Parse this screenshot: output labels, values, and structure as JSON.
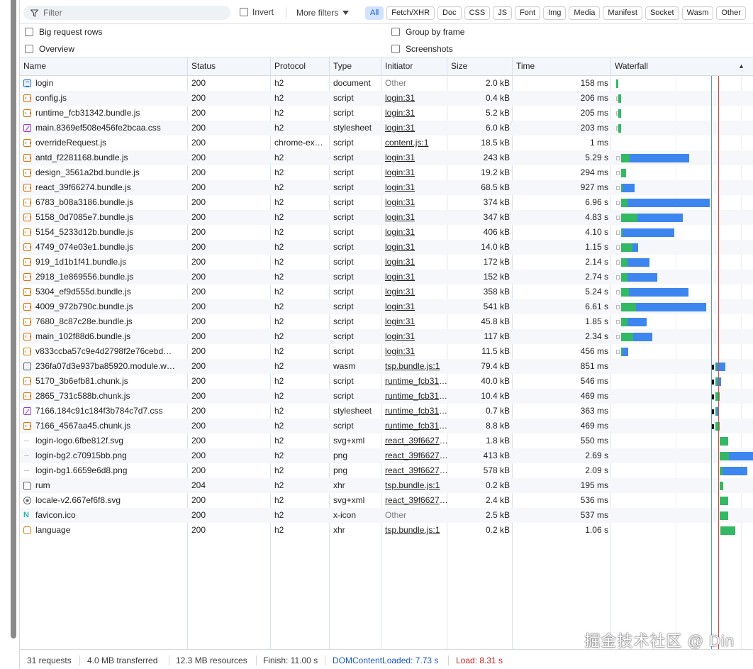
{
  "toolbar": {
    "filter_placeholder": "Filter",
    "invert_label": "Invert",
    "more_filters_label": "More filters",
    "chips": [
      {
        "label": "All",
        "active": true
      },
      {
        "label": "Fetch/XHR",
        "active": false
      },
      {
        "label": "Doc",
        "active": false
      },
      {
        "label": "CSS",
        "active": false
      },
      {
        "label": "JS",
        "active": false
      },
      {
        "label": "Font",
        "active": false
      },
      {
        "label": "Img",
        "active": false
      },
      {
        "label": "Media",
        "active": false
      },
      {
        "label": "Manifest",
        "active": false
      },
      {
        "label": "Socket",
        "active": false
      },
      {
        "label": "Wasm",
        "active": false
      },
      {
        "label": "Other",
        "active": false
      }
    ]
  },
  "options": {
    "big_request_rows": "Big request rows",
    "overview": "Overview",
    "group_by_frame": "Group by frame",
    "screenshots": "Screenshots"
  },
  "columns": {
    "name": "Name",
    "status": "Status",
    "protocol": "Protocol",
    "type": "Type",
    "initiator": "Initiator",
    "size": "Size",
    "time": "Time",
    "waterfall": "Waterfall",
    "waterfall_sort": "▲"
  },
  "rows": [
    {
      "icon": "document",
      "name": "login",
      "status": "200",
      "protocol": "h2",
      "type": "document",
      "initiator": "Other",
      "initiator_link": false,
      "size": "2.0 kB",
      "time": "158 ms",
      "wf": [
        [
          "w",
          6,
          3
        ]
      ]
    },
    {
      "icon": "script",
      "name": "config.js",
      "status": "200",
      "protocol": "h2",
      "type": "script",
      "initiator": "login:31",
      "initiator_link": true,
      "size": "0.4 kB",
      "time": "206 ms",
      "wf": [
        [
          "q",
          6,
          3
        ],
        [
          "w",
          9,
          4
        ]
      ]
    },
    {
      "icon": "script",
      "name": "runtime_fcb31342.bundle.js",
      "status": "200",
      "protocol": "h2",
      "type": "script",
      "initiator": "login:31",
      "initiator_link": true,
      "size": "5.2 kB",
      "time": "205 ms",
      "wf": [
        [
          "q",
          6,
          3
        ],
        [
          "w",
          9,
          4
        ]
      ]
    },
    {
      "icon": "stylesheet",
      "name": "main.8369ef508e456fe2bcaa.css",
      "status": "200",
      "protocol": "h2",
      "type": "stylesheet",
      "initiator": "login:31",
      "initiator_link": true,
      "size": "6.0 kB",
      "time": "203 ms",
      "wf": [
        [
          "q",
          6,
          3
        ],
        [
          "w",
          9,
          4
        ]
      ]
    },
    {
      "icon": "script",
      "name": "overrideRequest.js",
      "status": "200",
      "protocol": "chrome-ex…",
      "type": "script",
      "initiator": "content.js:1",
      "initiator_link": true,
      "size": "18.5 kB",
      "time": "1 ms",
      "wf": []
    },
    {
      "icon": "script",
      "name": "antd_f2281168.bundle.js",
      "status": "200",
      "protocol": "h2",
      "type": "script",
      "initiator": "login:31",
      "initiator_link": true,
      "size": "243 kB",
      "time": "5.29 s",
      "wf": [
        [
          "q",
          6,
          5
        ],
        [
          "w",
          13,
          12
        ],
        [
          "d",
          25,
          84
        ]
      ]
    },
    {
      "icon": "script",
      "name": "design_3561a2bd.bundle.js",
      "status": "200",
      "protocol": "h2",
      "type": "script",
      "initiator": "login:31",
      "initiator_link": true,
      "size": "19.2 kB",
      "time": "294 ms",
      "wf": [
        [
          "q",
          6,
          5
        ],
        [
          "w",
          13,
          7
        ]
      ]
    },
    {
      "icon": "script",
      "name": "react_39f66274.bundle.js",
      "status": "200",
      "protocol": "h2",
      "type": "script",
      "initiator": "login:31",
      "initiator_link": true,
      "size": "68.5 kB",
      "time": "927 ms",
      "wf": [
        [
          "q",
          6,
          5
        ],
        [
          "w",
          13,
          2
        ],
        [
          "d",
          15,
          17
        ]
      ]
    },
    {
      "icon": "script",
      "name": "6783_b08a3186.bundle.js",
      "status": "200",
      "protocol": "h2",
      "type": "script",
      "initiator": "login:31",
      "initiator_link": true,
      "size": "374 kB",
      "time": "6.96 s",
      "wf": [
        [
          "q",
          6,
          5
        ],
        [
          "w",
          13,
          9
        ],
        [
          "d",
          22,
          116
        ]
      ]
    },
    {
      "icon": "script",
      "name": "5158_0d7085e7.bundle.js",
      "status": "200",
      "protocol": "h2",
      "type": "script",
      "initiator": "login:31",
      "initiator_link": true,
      "size": "347 kB",
      "time": "4.83 s",
      "wf": [
        [
          "q",
          6,
          5
        ],
        [
          "w",
          13,
          23
        ],
        [
          "d",
          36,
          64
        ]
      ]
    },
    {
      "icon": "script",
      "name": "5154_5233d12b.bundle.js",
      "status": "200",
      "protocol": "h2",
      "type": "script",
      "initiator": "login:31",
      "initiator_link": true,
      "size": "406 kB",
      "time": "4.10 s",
      "wf": [
        [
          "q",
          6,
          5
        ],
        [
          "w",
          13,
          2
        ],
        [
          "d",
          15,
          73
        ]
      ]
    },
    {
      "icon": "script",
      "name": "4749_074e03e1.bundle.js",
      "status": "200",
      "protocol": "h2",
      "type": "script",
      "initiator": "login:31",
      "initiator_link": true,
      "size": "14.0 kB",
      "time": "1.15 s",
      "wf": [
        [
          "q",
          6,
          5
        ],
        [
          "w",
          13,
          16
        ],
        [
          "d",
          29,
          8
        ]
      ]
    },
    {
      "icon": "script",
      "name": "919_1d1b1f41.bundle.js",
      "status": "200",
      "protocol": "h2",
      "type": "script",
      "initiator": "login:31",
      "initiator_link": true,
      "size": "172 kB",
      "time": "2.14 s",
      "wf": [
        [
          "q",
          6,
          5
        ],
        [
          "w",
          13,
          9
        ],
        [
          "d",
          22,
          31
        ]
      ]
    },
    {
      "icon": "script",
      "name": "2918_1e869556.bundle.js",
      "status": "200",
      "protocol": "h2",
      "type": "script",
      "initiator": "login:31",
      "initiator_link": true,
      "size": "152 kB",
      "time": "2.74 s",
      "wf": [
        [
          "q",
          6,
          5
        ],
        [
          "w",
          13,
          9
        ],
        [
          "d",
          22,
          42
        ]
      ]
    },
    {
      "icon": "script",
      "name": "5304_ef9d555d.bundle.js",
      "status": "200",
      "protocol": "h2",
      "type": "script",
      "initiator": "login:31",
      "initiator_link": true,
      "size": "358 kB",
      "time": "5.24 s",
      "wf": [
        [
          "q",
          6,
          5
        ],
        [
          "w",
          13,
          11
        ],
        [
          "d",
          24,
          84
        ]
      ]
    },
    {
      "icon": "script",
      "name": "4009_972b790c.bundle.js",
      "status": "200",
      "protocol": "h2",
      "type": "script",
      "initiator": "login:31",
      "initiator_link": true,
      "size": "541 kB",
      "time": "6.61 s",
      "wf": [
        [
          "q",
          6,
          5
        ],
        [
          "w",
          13,
          21
        ],
        [
          "d",
          34,
          99
        ]
      ]
    },
    {
      "icon": "script",
      "name": "7680_8c87c28e.bundle.js",
      "status": "200",
      "protocol": "h2",
      "type": "script",
      "initiator": "login:31",
      "initiator_link": true,
      "size": "45.8 kB",
      "time": "1.85 s",
      "wf": [
        [
          "q",
          6,
          5
        ],
        [
          "w",
          13,
          9
        ],
        [
          "d",
          22,
          27
        ]
      ]
    },
    {
      "icon": "script",
      "name": "main_102f88d6.bundle.js",
      "status": "200",
      "protocol": "h2",
      "type": "script",
      "initiator": "login:31",
      "initiator_link": true,
      "size": "117 kB",
      "time": "2.34 s",
      "wf": [
        [
          "q",
          6,
          5
        ],
        [
          "w",
          13,
          17
        ],
        [
          "d",
          30,
          27
        ]
      ]
    },
    {
      "icon": "script",
      "name": "v833ccba57c9e4d2798f2e76cebd…",
      "status": "200",
      "protocol": "h2",
      "type": "script",
      "initiator": "login:31",
      "initiator_link": true,
      "size": "11.5 kB",
      "time": "456 ms",
      "wf": [
        [
          "q",
          6,
          5
        ],
        [
          "w",
          13,
          2
        ],
        [
          "d",
          15,
          8
        ]
      ]
    },
    {
      "icon": "wasm",
      "name": "236fa07d3e937ba85920.module.w…",
      "status": "200",
      "protocol": "h2",
      "type": "wasm",
      "initiator": "tsp.bundle.js:1",
      "initiator_link": true,
      "size": "79.4 kB",
      "time": "851 ms",
      "wf": [
        [
          "k",
          140,
          4
        ],
        [
          "tw",
          146,
          3
        ],
        [
          "d",
          149,
          11
        ]
      ]
    },
    {
      "icon": "script",
      "name": "5170_3b6efb81.chunk.js",
      "status": "200",
      "protocol": "h2",
      "type": "script",
      "initiator": "runtime_fcb313…",
      "initiator_link": true,
      "size": "40.0 kB",
      "time": "546 ms",
      "wf": [
        [
          "k",
          140,
          4
        ],
        [
          "w",
          146,
          3
        ],
        [
          "d",
          149,
          5
        ]
      ]
    },
    {
      "icon": "script",
      "name": "2865_731c588b.chunk.js",
      "status": "200",
      "protocol": "h2",
      "type": "script",
      "initiator": "runtime_fcb313…",
      "initiator_link": true,
      "size": "10.4 kB",
      "time": "469 ms",
      "wf": [
        [
          "k",
          140,
          4
        ],
        [
          "w",
          146,
          6
        ]
      ]
    },
    {
      "icon": "stylesheet",
      "name": "7166.184c91c184f3b784c7d7.css",
      "status": "200",
      "protocol": "h2",
      "type": "stylesheet",
      "initiator": "runtime_fcb313…",
      "initiator_link": true,
      "size": "0.7 kB",
      "time": "363 ms",
      "wf": [
        [
          "k",
          140,
          4
        ],
        [
          "w",
          146,
          2
        ],
        [
          "d",
          148,
          3
        ]
      ]
    },
    {
      "icon": "script",
      "name": "7166_4567aa45.chunk.js",
      "status": "200",
      "protocol": "h2",
      "type": "script",
      "initiator": "runtime_fcb313…",
      "initiator_link": true,
      "size": "8.8 kB",
      "time": "469 ms",
      "wf": [
        [
          "k",
          140,
          4
        ],
        [
          "w",
          146,
          6
        ]
      ]
    },
    {
      "icon": "image",
      "name": "login-logo.6fbe812f.svg",
      "status": "200",
      "protocol": "h2",
      "type": "svg+xml",
      "initiator": "react_39f66274…",
      "initiator_link": true,
      "size": "1.8 kB",
      "time": "550 ms",
      "wf": [
        [
          "w",
          152,
          12
        ]
      ]
    },
    {
      "icon": "image",
      "name": "login-bg2.c70915bb.png",
      "status": "200",
      "protocol": "h2",
      "type": "png",
      "initiator": "react_39f66274…",
      "initiator_link": true,
      "size": "413 kB",
      "time": "2.69 s",
      "wf": [
        [
          "w",
          152,
          13
        ],
        [
          "d",
          165,
          34
        ]
      ]
    },
    {
      "icon": "image",
      "name": "login-bg1.6659e6d8.png",
      "status": "200",
      "protocol": "h2",
      "type": "png",
      "initiator": "react_39f66274…",
      "initiator_link": true,
      "size": "578 kB",
      "time": "2.09 s",
      "wf": [
        [
          "w",
          152,
          4
        ],
        [
          "d",
          156,
          35
        ]
      ]
    },
    {
      "icon": "xhr",
      "name": "rum",
      "status": "204",
      "protocol": "h2",
      "type": "xhr",
      "initiator": "tsp.bundle.js:1",
      "initiator_link": true,
      "size": "0.2 kB",
      "time": "195 ms",
      "wf": [
        [
          "w",
          152,
          5
        ]
      ]
    },
    {
      "icon": "globe",
      "name": "locale-v2.667ef6f8.svg",
      "status": "200",
      "protocol": "h2",
      "type": "svg+xml",
      "initiator": "react_39f66274…",
      "initiator_link": true,
      "size": "2.4 kB",
      "time": "536 ms",
      "wf": [
        [
          "w",
          152,
          12
        ]
      ]
    },
    {
      "icon": "favicon",
      "name": "favicon.ico",
      "status": "200",
      "protocol": "h2",
      "type": "x-icon",
      "initiator": "Other",
      "initiator_link": false,
      "size": "2.5 kB",
      "time": "537 ms",
      "wf": [
        [
          "w",
          152,
          12
        ]
      ]
    },
    {
      "icon": "fetch",
      "name": "language",
      "status": "200",
      "protocol": "h2",
      "type": "xhr",
      "initiator": "tsp.bundle.js:1",
      "initiator_link": true,
      "size": "0.2 kB",
      "time": "1.06 s",
      "wf": [
        [
          "w",
          153,
          21
        ]
      ]
    }
  ],
  "statusbar": {
    "requests": "31 requests",
    "transferred": "4.0 MB transferred",
    "resources": "12.3 MB resources",
    "finish": "Finish: 11.00 s",
    "dom_content_loaded": "DOMContentLoaded: 7.73 s",
    "load": "Load: 8.31 s"
  },
  "watermark": "掘金技术社区 @ Din",
  "colors": {
    "waiting": "#33b864",
    "download": "#3d86ef",
    "dom_line": "#6d8fd8",
    "load_line": "#d24848",
    "active_chip": "#d3e3fd"
  }
}
